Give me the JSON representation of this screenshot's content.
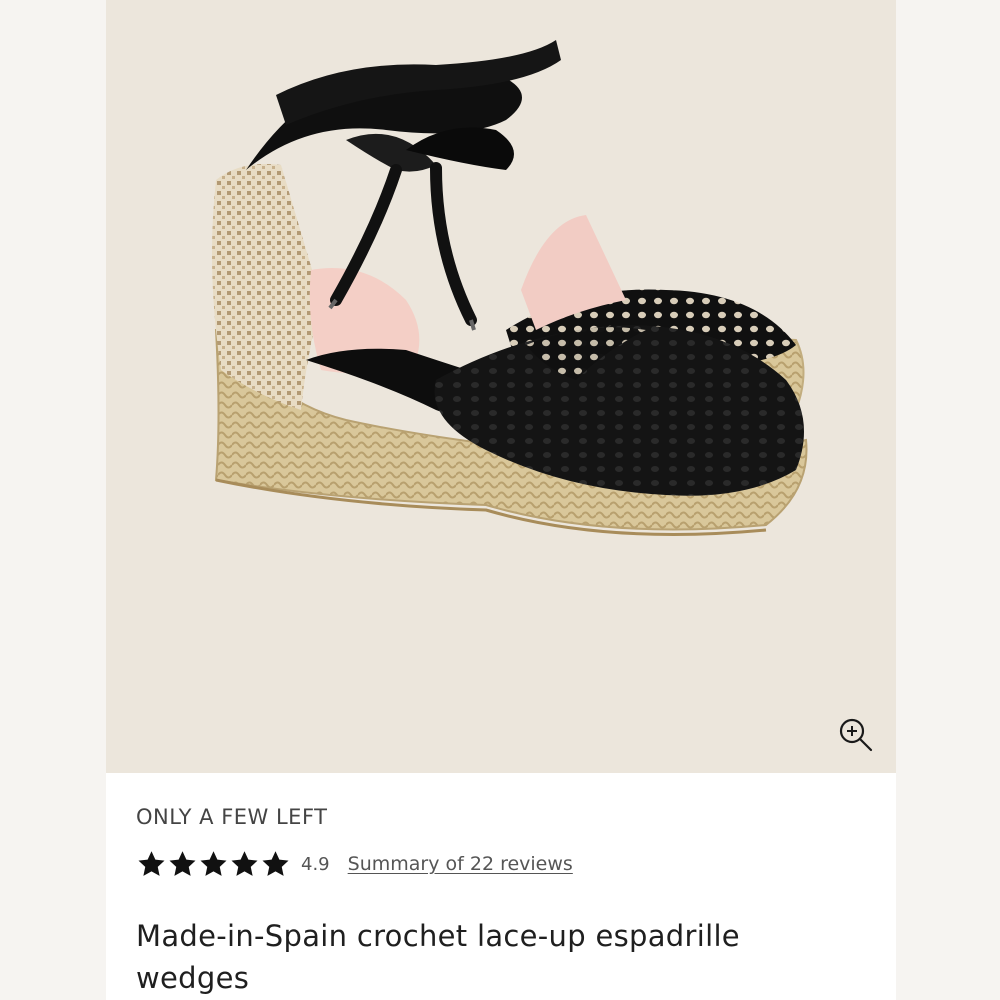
{
  "product": {
    "image_alt": "Black crochet lace-up espadrille wedge shoes",
    "zoom_icon": "zoom-in-icon",
    "stock_status": "ONLY A FEW LEFT",
    "rating": {
      "stars": 5,
      "value": "4.9",
      "reviews_link": "Summary of 22 reviews"
    },
    "title": "Made-in-Spain crochet lace-up espadrille wedges"
  },
  "colors": {
    "image_background": "#ece6dc",
    "star": "#111111",
    "text": "#1f1f1f"
  }
}
